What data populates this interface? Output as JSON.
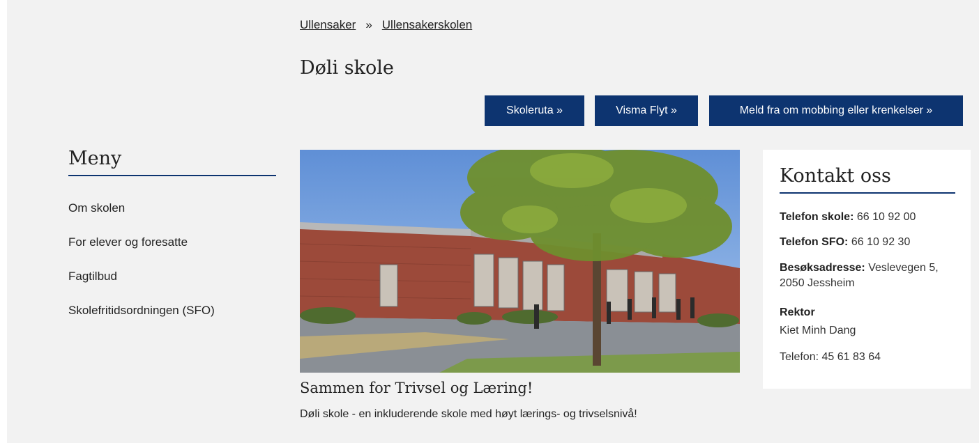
{
  "breadcrumb": {
    "items": [
      "Ullensaker",
      "Ullensakerskolen"
    ],
    "separator": "»"
  },
  "page_title": "Døli skole",
  "buttons": {
    "skoleruta": "Skoleruta  »",
    "visma": "Visma Flyt  »",
    "meld": "Meld fra om mobbing eller krenkelser  »"
  },
  "menu": {
    "heading": "Meny",
    "items": [
      "Om skolen",
      "For elever og foresatte",
      "Fagtilbud",
      "Skolefritidsordningen (SFO)"
    ]
  },
  "hero": {
    "caption_title": "Sammen for Trivsel og Læring!",
    "caption_text": "Døli skole - en inkluderende skole med høyt lærings- og trivselsnivå!"
  },
  "contact": {
    "heading": "Kontakt oss",
    "phone_school_label": "Telefon skole:",
    "phone_school_value": " 66 10 92 00",
    "phone_sfo_label": "Telefon SFO:",
    "phone_sfo_value": " 66 10 92 30",
    "address_label": "Besøksadresse:",
    "address_value": " Veslevegen 5, 2050 Jessheim",
    "rektor_label": "Rektor",
    "rektor_name": "Kiet Minh Dang",
    "rektor_phone": "Telefon: 45 61 83 64"
  },
  "colors": {
    "brand_blue": "#0d3470",
    "page_background": "#f2f2f2"
  }
}
